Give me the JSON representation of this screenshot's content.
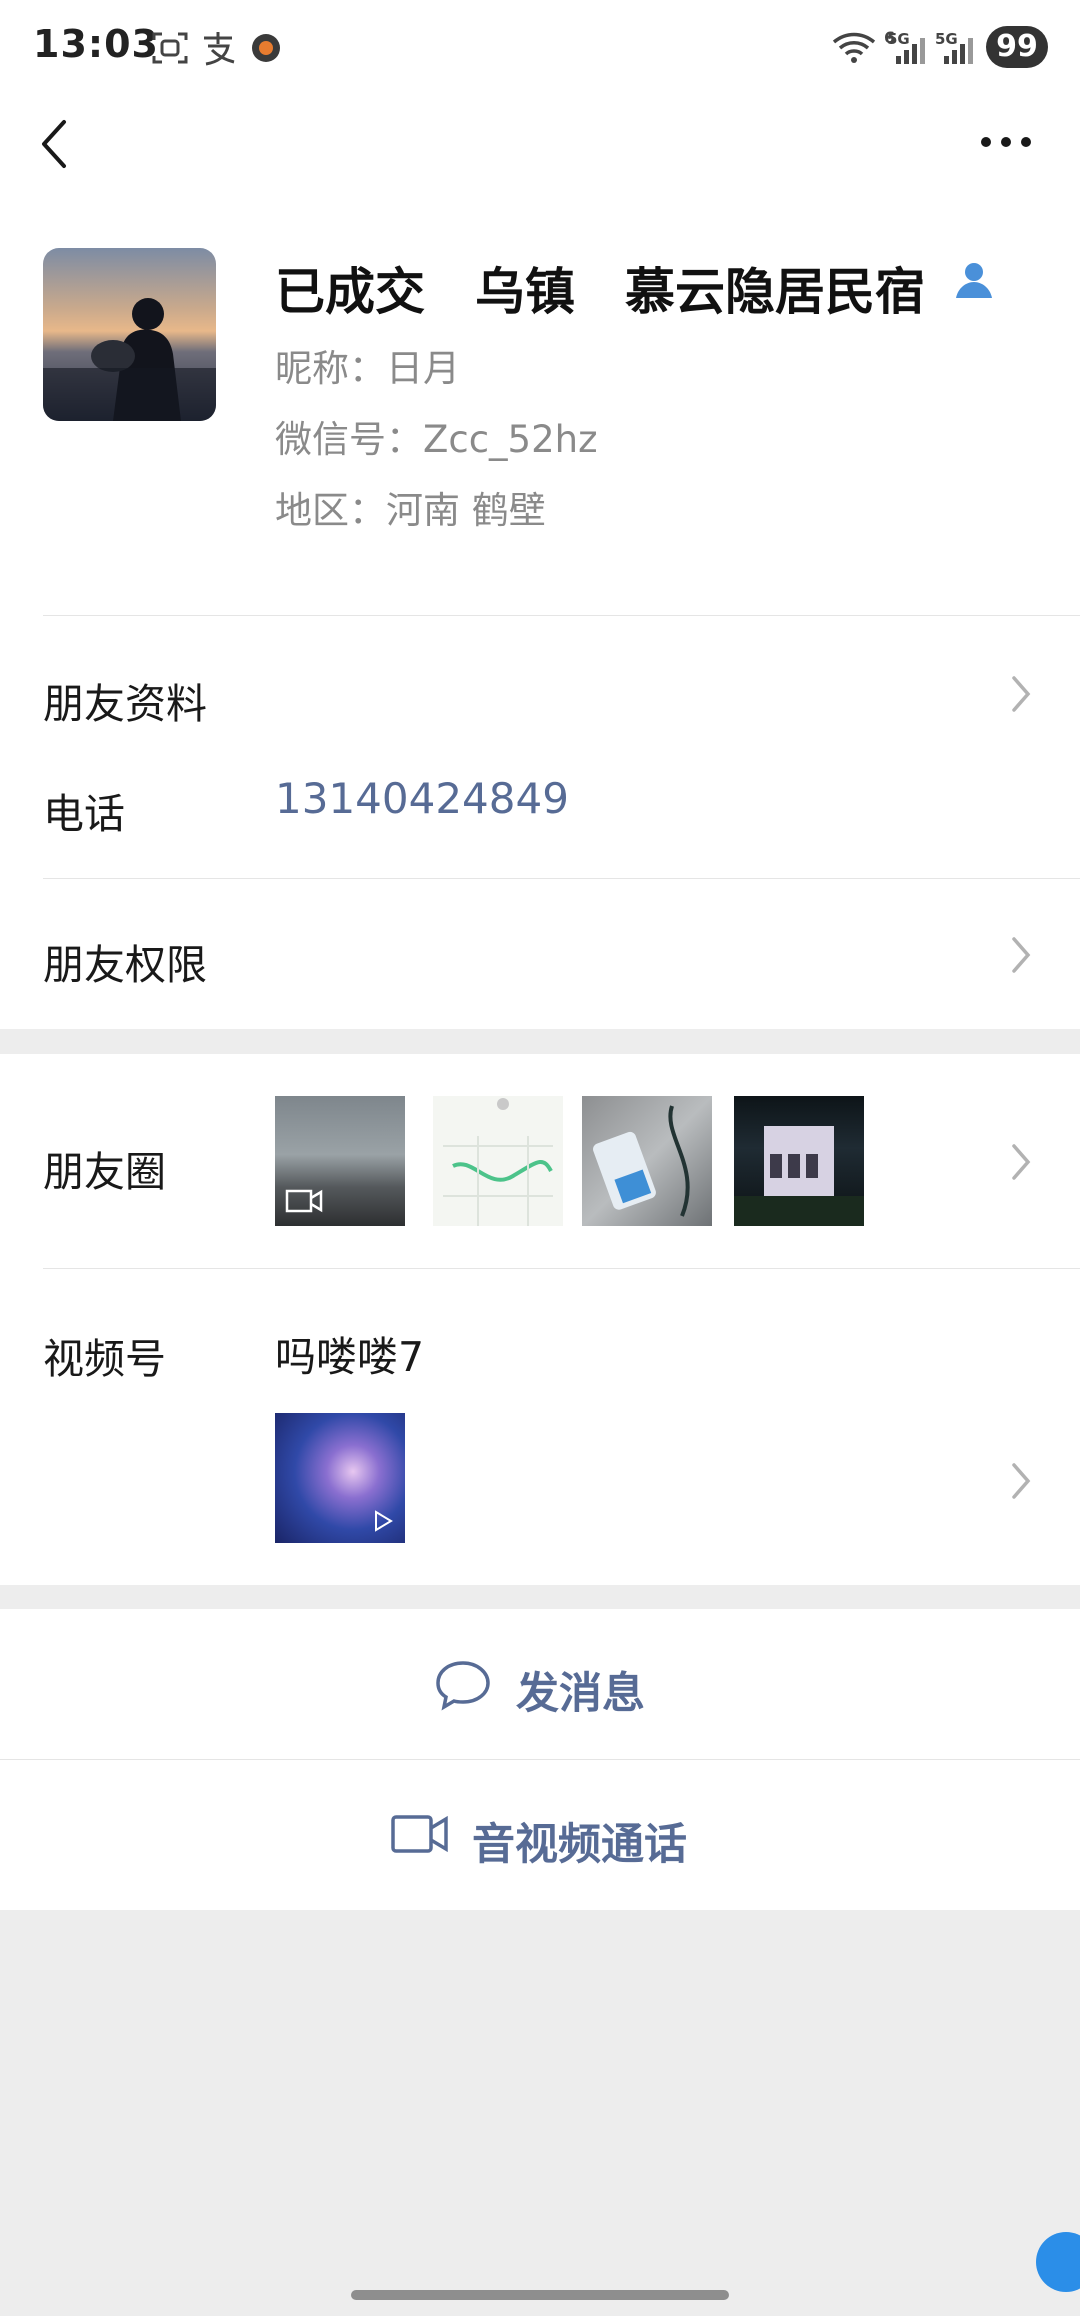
{
  "status_bar": {
    "time": "13:03",
    "icons": [
      "scan-icon",
      "alipay-icon",
      "app-icon",
      "wifi-icon",
      "signal-5g-icon",
      "signal-5g-icon"
    ],
    "net_labels": [
      "6",
      "5G",
      "5G"
    ],
    "battery": "99"
  },
  "nav": {
    "back_icon": "back-chevron-icon",
    "more_icon": "more-dots-icon"
  },
  "profile": {
    "remark_name": "已成交　乌镇　慕云隐居民宿",
    "nickname": "昵称：日月",
    "wechat_id": "微信号：Zcc_52hz",
    "region": "地区：河南  鹤壁",
    "contact_icon": "person-icon"
  },
  "rows": {
    "friend_info": "朋友资料",
    "phone_label": "电话",
    "phone_value": "13140424849",
    "friend_permissions": "朋友权限",
    "moments": "朋友圈",
    "channels": "视频号",
    "channel_name": "吗喽喽7"
  },
  "actions": {
    "send_message": "发消息",
    "video_call": "音视频通话"
  },
  "colors": {
    "link": "#576b95",
    "background": "#ededed",
    "accent": "#2b8ee8"
  }
}
